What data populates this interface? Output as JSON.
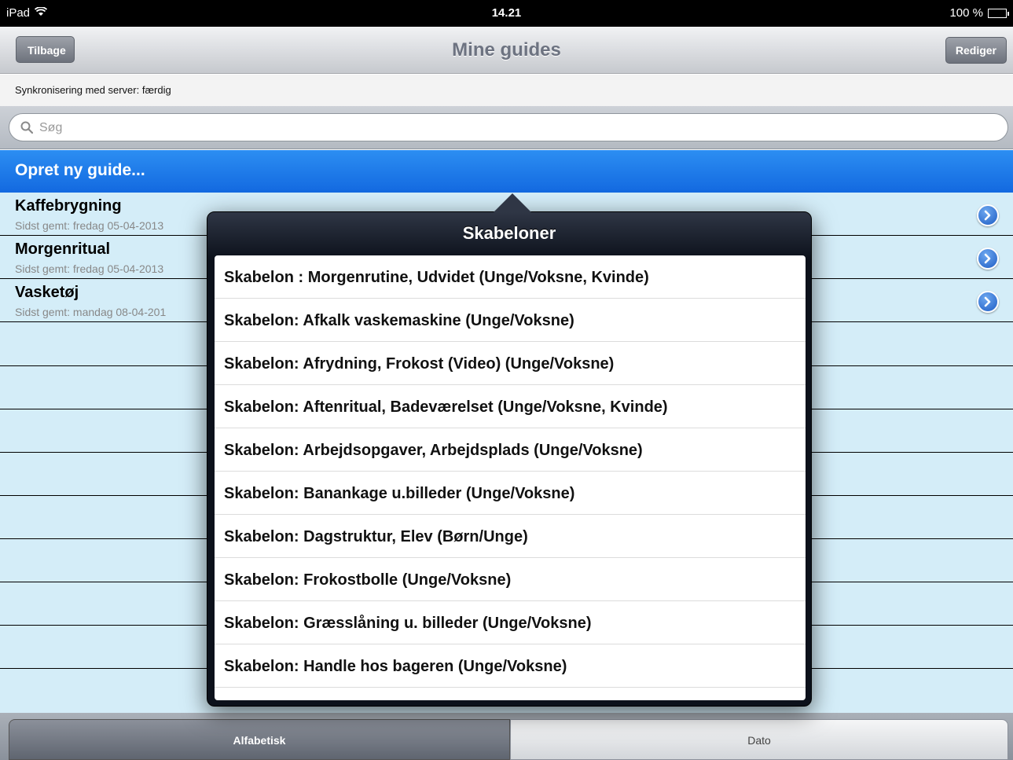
{
  "status_bar": {
    "device": "iPad",
    "time": "14.21",
    "battery": "100 %",
    "wifi_icon": "wifi-icon",
    "battery_icon": "battery-icon"
  },
  "nav_bar": {
    "back_label": "Tilbage",
    "title": "Mine guides",
    "edit_label": "Rediger"
  },
  "sync": {
    "text": "Synkronisering med server:  færdig"
  },
  "search": {
    "placeholder": "Søg",
    "icon": "search-icon"
  },
  "create": {
    "label": "Opret ny guide..."
  },
  "guides": [
    {
      "name": "Kaffebrygning",
      "saved": "Sidst gemt: fredag 05-04-2013"
    },
    {
      "name": "Morgenritual",
      "saved": "Sidst gemt: fredag 05-04-2013"
    },
    {
      "name": "Vasketøj",
      "saved": "Sidst gemt: mandag 08-04-201"
    }
  ],
  "popover": {
    "title": "Skabeloner",
    "templates": [
      "Skabelon : Morgenrutine, Udvidet (Unge/Voksne, Kvinde)",
      "Skabelon: Afkalk vaskemaskine (Unge/Voksne)",
      "Skabelon: Afrydning, Frokost (Video) (Unge/Voksne)",
      "Skabelon: Aftenritual, Badeværelset (Unge/Voksne, Kvinde)",
      "Skabelon: Arbejdsopgaver, Arbejdsplads (Unge/Voksne)",
      "Skabelon: Banankage u.billeder (Unge/Voksne)",
      "Skabelon: Dagstruktur, Elev (Børn/Unge)",
      "Skabelon: Frokostbolle (Unge/Voksne)",
      "Skabelon: Græsslåning u. billeder (Unge/Voksne)",
      "Skabelon: Handle hos bageren (Unge/Voksne)"
    ]
  },
  "sort_tabs": {
    "alphabetical": "Alfabetisk",
    "date": "Dato",
    "selected": "Alfabetisk"
  },
  "colors": {
    "accent_blue": "#1a73e8",
    "list_background": "#d4edf8",
    "popover_dark": "#0c111b"
  }
}
